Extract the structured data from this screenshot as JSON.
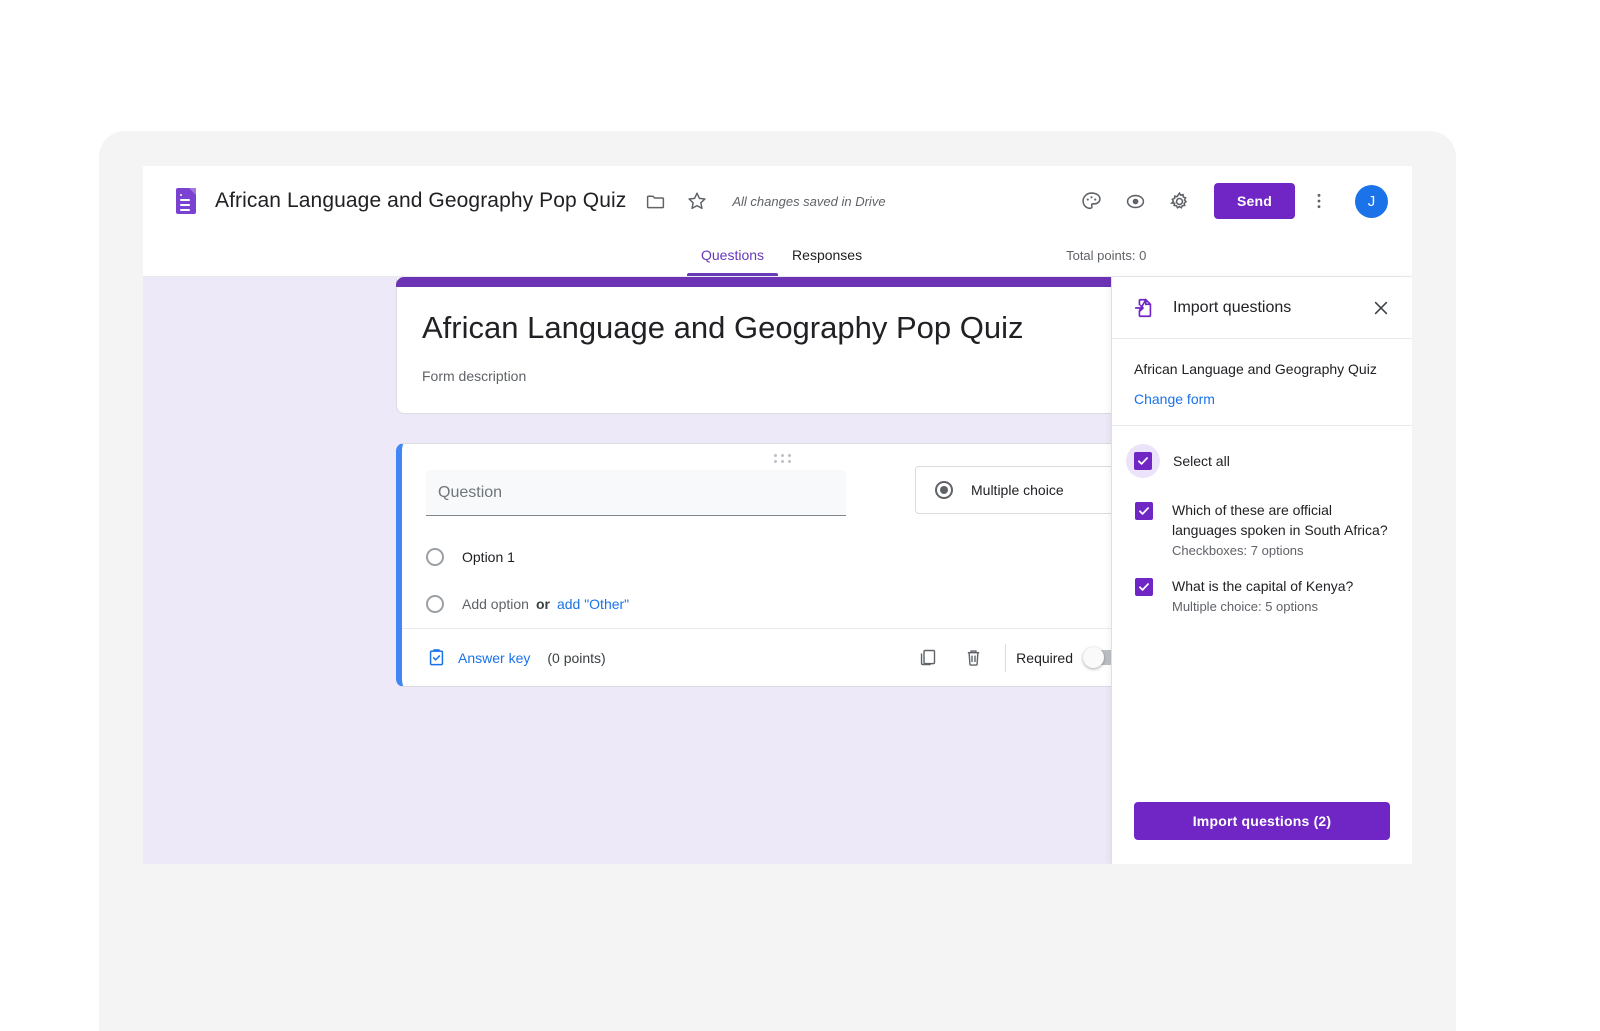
{
  "header": {
    "logo_icon": "google-forms-icon",
    "form_title": "African Language and Geography Pop Quiz",
    "folder_icon": "folder-icon",
    "star_icon": "star-icon",
    "save_status": "All changes saved in Drive",
    "theme_icon": "palette-icon",
    "preview_icon": "eye-icon",
    "settings_icon": "gear-icon",
    "send_label": "Send",
    "more_icon": "kebab-menu-icon",
    "avatar_initial": "J"
  },
  "tabs": {
    "questions": "Questions",
    "responses": "Responses",
    "total_points": "Total points: 0"
  },
  "form": {
    "title": "African Language and Geography Pop Quiz",
    "description": "Form description"
  },
  "question": {
    "placeholder": "Question",
    "type_label": "Multiple choice",
    "type_icon": "radio-filled-icon",
    "caret_icon": "chevron-down-icon",
    "option1": "Option 1",
    "add_option": "Add option",
    "or": "or",
    "add_other": "add \"Other\"",
    "answer_key_icon": "answer-key-icon",
    "answer_key": "Answer key",
    "points": "(0 points)",
    "duplicate_icon": "duplicate-icon",
    "delete_icon": "trash-icon",
    "required_label": "Required",
    "more_icon": "kebab-menu-icon"
  },
  "panel": {
    "icon": "import-file-icon",
    "title": "Import questions",
    "close_icon": "close-icon",
    "source_form_name": "African Language and Geography Quiz",
    "change_form": "Change form",
    "select_all": "Select all",
    "items": [
      {
        "title": "Which of these are official languages spoken in South Africa?",
        "subtitle": "Checkboxes: 7 options",
        "checked": true
      },
      {
        "title": "What is the capital of Kenya?",
        "subtitle": "Multiple choice: 5 options",
        "checked": true
      }
    ],
    "import_button": "Import questions (2)"
  },
  "colors": {
    "purple": "#7026c4",
    "theme_bar": "#6c33b5",
    "canvas_bg": "#ede9f8",
    "accent_blue": "#4285f4",
    "link_blue": "#1a73e8",
    "avatar_blue": "#1a73e8"
  }
}
